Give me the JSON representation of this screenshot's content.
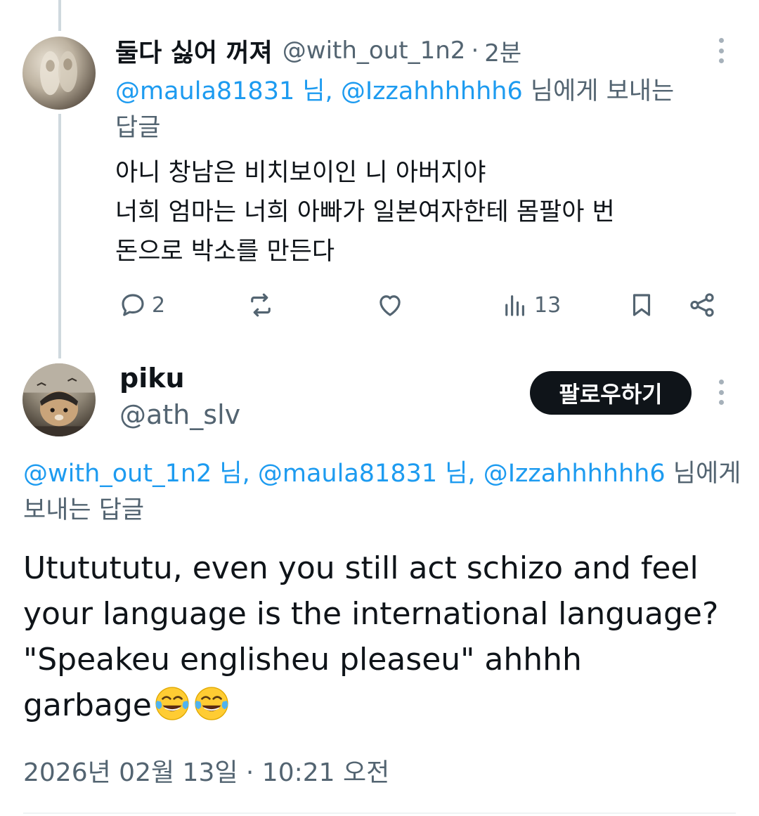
{
  "colors": {
    "text": "#0f1419",
    "secondary": "#536471",
    "mention": "#1d9bf0",
    "follow_bg": "#0f1419",
    "thread_line": "#cfd9de"
  },
  "tweet1": {
    "display_name": "둘다 싫어 꺼져",
    "handle": "@with_out_1n2",
    "separator": "·",
    "time": "2분",
    "reply_to": {
      "mention1": "@maula81831 님,",
      "mention2": "@Izzahhhhhh6",
      "suffix_line1": " 님에게 보내는",
      "suffix_line2": "답글"
    },
    "body_lines": [
      "아니 창남은 비치보이인 니 아버지야",
      "너희 엄마는 너희 아빠가 일본여자한테 몸팔아 번",
      "돈으로 박소를 만든다"
    ],
    "actions": {
      "reply_icon": "reply-bubble-icon",
      "reply_count": "2",
      "retweet_icon": "retweet-icon",
      "like_icon": "heart-icon",
      "views_icon": "views-bar-chart-icon",
      "views_count": "13",
      "bookmark_icon": "bookmark-icon",
      "share_icon": "share-icon"
    },
    "more_icon": "more-dots-icon"
  },
  "tweet2": {
    "display_name": "piku",
    "handle": "@ath_slv",
    "follow_label": "팔로우하기",
    "reply_to": {
      "mention1": "@with_out_1n2 님,",
      "mention2": "@maula81831 님,",
      "mention3": "@Izzahhhhhh6",
      "suffix_line1": " 님에게",
      "suffix_line2": "보내는 답글"
    },
    "body_lines": [
      "Ututututu, even you still act schizo and feel",
      "your language is the international language?",
      "\"Speakeu englisheu pleaseu\" ahhhh",
      "garbage"
    ],
    "body_emoji": "face-with-tears-of-joy-icon",
    "timestamp": "2026년 02월 13일 · 10:21 오전",
    "more_icon": "more-dots-icon"
  }
}
